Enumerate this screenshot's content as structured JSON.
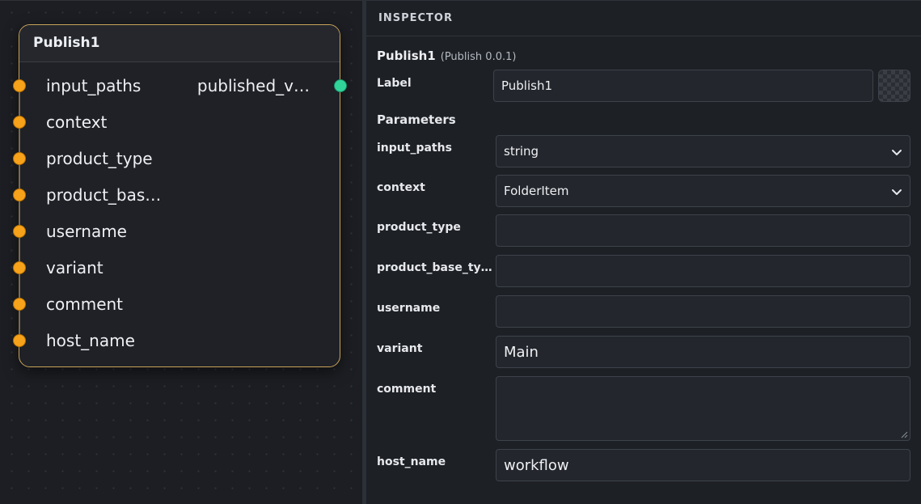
{
  "node": {
    "title": "Publish1",
    "inputs": [
      "input_paths",
      "context",
      "product_type",
      "product_bas…",
      "username",
      "variant",
      "comment",
      "host_name"
    ],
    "output": "published_v…"
  },
  "inspector": {
    "header": "INSPECTOR",
    "node_name": "Publish1",
    "node_version": "(Publish 0.0.1)",
    "label_field": {
      "label": "Label",
      "value": "Publish1"
    },
    "parameters_title": "Parameters",
    "params": {
      "input_paths": {
        "label": "input_paths",
        "value": "string"
      },
      "context": {
        "label": "context",
        "value": "FolderItem"
      },
      "product_type": {
        "label": "product_type",
        "value": ""
      },
      "product_base_type": {
        "label": "product_base_ty…",
        "value": ""
      },
      "username": {
        "label": "username",
        "value": ""
      },
      "variant": {
        "label": "variant",
        "value": "Main"
      },
      "comment": {
        "label": "comment",
        "value": ""
      },
      "host_name": {
        "label": "host_name",
        "value": "workflow"
      }
    }
  },
  "colors": {
    "input_port": "#f7a21b",
    "output_port": "#31d59a",
    "node_border": "#c9a35a"
  }
}
